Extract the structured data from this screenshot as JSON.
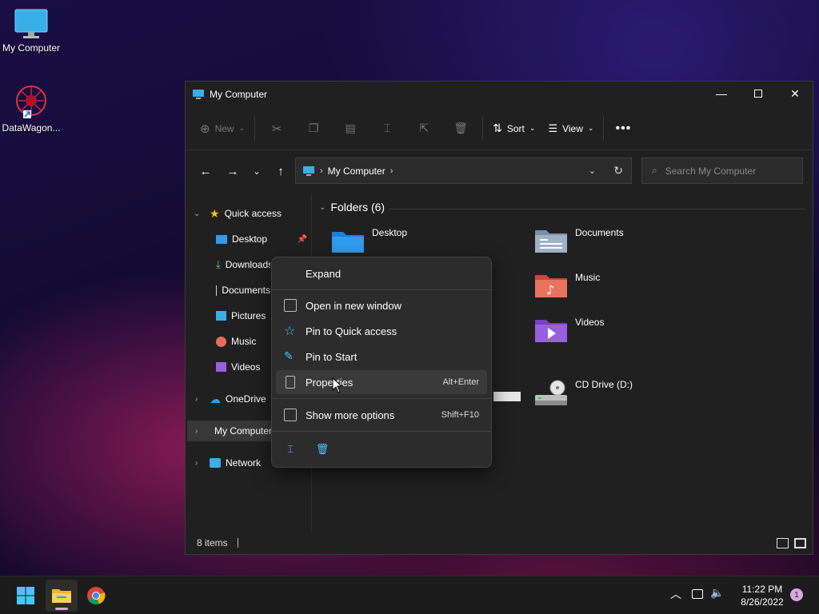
{
  "desktop": {
    "icons": [
      {
        "label": "My Computer"
      },
      {
        "label": "DataWagon..."
      }
    ]
  },
  "window": {
    "title": "My Computer",
    "toolbar": {
      "new_label": "New",
      "sort_label": "Sort",
      "view_label": "View"
    },
    "address": {
      "path": "My Computer"
    },
    "search": {
      "placeholder": "Search My Computer"
    },
    "sidebar": {
      "quick_access": "Quick access",
      "items": [
        {
          "label": "Desktop"
        },
        {
          "label": "Downloads"
        },
        {
          "label": "Documents"
        },
        {
          "label": "Pictures"
        },
        {
          "label": "Music"
        },
        {
          "label": "Videos"
        }
      ],
      "onedrive": "OneDrive",
      "mycomputer": "My Computer",
      "network": "Network"
    },
    "content": {
      "section": "Folders (6)",
      "folders": [
        {
          "label": "Desktop"
        },
        {
          "label": "Documents"
        },
        {
          "label": "Music"
        },
        {
          "label": "Videos"
        }
      ],
      "drive": {
        "label": "CD Drive (D:)"
      }
    },
    "status": {
      "items": "8 items"
    }
  },
  "context_menu": {
    "expand": "Expand",
    "open_new_window": "Open in new window",
    "pin_quick": "Pin to Quick access",
    "pin_start": "Pin to Start",
    "properties": "Properties",
    "properties_shortcut": "Alt+Enter",
    "more_options": "Show more options",
    "more_options_shortcut": "Shift+F10"
  },
  "taskbar": {
    "time": "11:22 PM",
    "date": "8/26/2022",
    "notification_count": "1"
  },
  "colors": {
    "accent": "#4cc2ff",
    "folder_blue": "#2f9bf0"
  }
}
